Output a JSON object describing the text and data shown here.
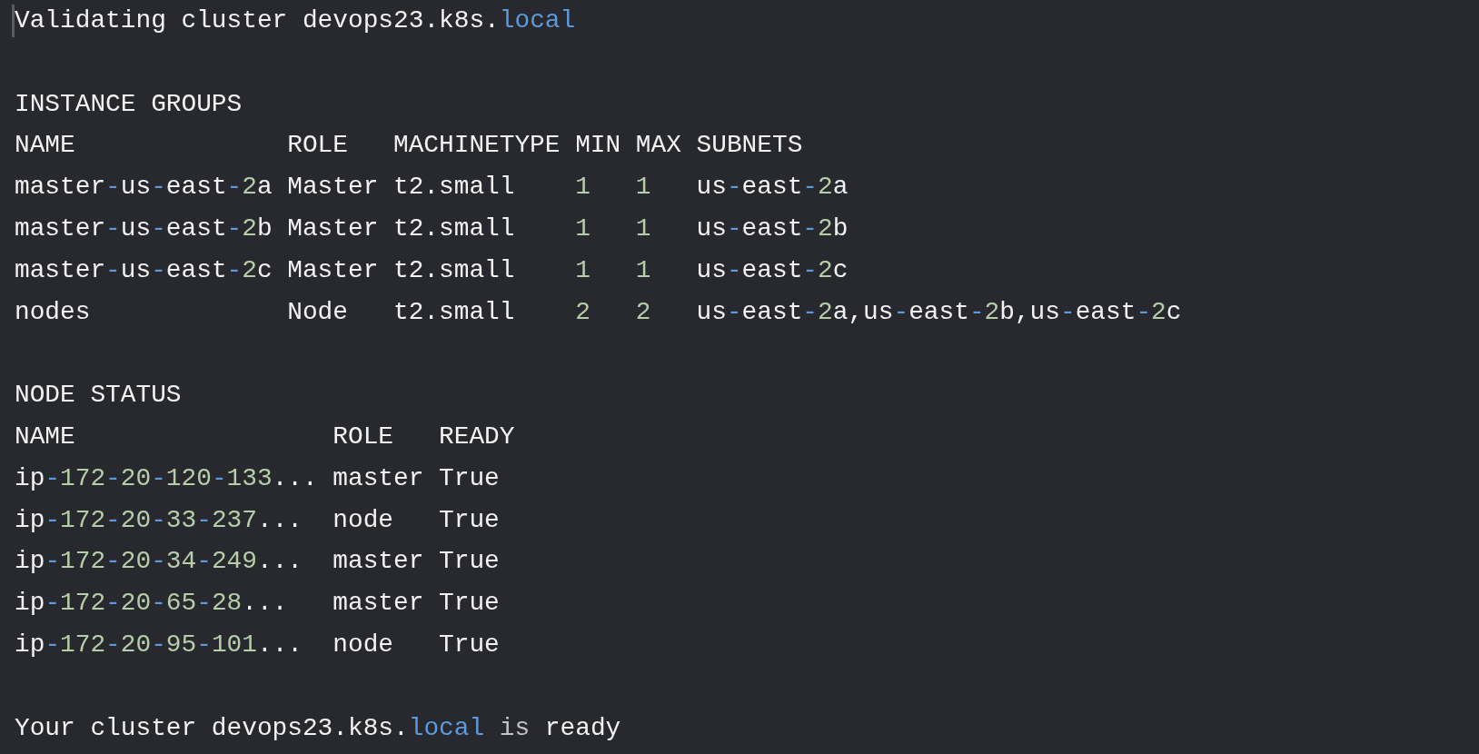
{
  "title_line": [
    {
      "text": "Validating cluster devops23.k8s.",
      "kind": "plain"
    },
    {
      "text": "local",
      "kind": "accent"
    }
  ],
  "instance_groups": {
    "heading": "INSTANCE GROUPS",
    "columns": [
      "NAME",
      "ROLE",
      "MACHINETYPE",
      "MIN",
      "MAX",
      "SUBNETS"
    ],
    "rows": [
      [
        [
          {
            "text": "master",
            "kind": "plain"
          },
          {
            "text": "-",
            "kind": "accent"
          },
          {
            "text": "us",
            "kind": "plain"
          },
          {
            "text": "-",
            "kind": "accent"
          },
          {
            "text": "east",
            "kind": "plain"
          },
          {
            "text": "-",
            "kind": "accent"
          },
          {
            "text": "2",
            "kind": "number"
          },
          {
            "text": "a",
            "kind": "plain"
          }
        ],
        [
          {
            "text": "Master",
            "kind": "plain"
          }
        ],
        [
          {
            "text": "t2.small",
            "kind": "plain"
          }
        ],
        [
          {
            "text": "1",
            "kind": "number"
          }
        ],
        [
          {
            "text": "1",
            "kind": "number"
          }
        ],
        [
          {
            "text": "us",
            "kind": "plain"
          },
          {
            "text": "-",
            "kind": "accent"
          },
          {
            "text": "east",
            "kind": "plain"
          },
          {
            "text": "-",
            "kind": "accent"
          },
          {
            "text": "2",
            "kind": "number"
          },
          {
            "text": "a",
            "kind": "plain"
          }
        ]
      ],
      [
        [
          {
            "text": "master",
            "kind": "plain"
          },
          {
            "text": "-",
            "kind": "accent"
          },
          {
            "text": "us",
            "kind": "plain"
          },
          {
            "text": "-",
            "kind": "accent"
          },
          {
            "text": "east",
            "kind": "plain"
          },
          {
            "text": "-",
            "kind": "accent"
          },
          {
            "text": "2",
            "kind": "number"
          },
          {
            "text": "b",
            "kind": "plain"
          }
        ],
        [
          {
            "text": "Master",
            "kind": "plain"
          }
        ],
        [
          {
            "text": "t2.small",
            "kind": "plain"
          }
        ],
        [
          {
            "text": "1",
            "kind": "number"
          }
        ],
        [
          {
            "text": "1",
            "kind": "number"
          }
        ],
        [
          {
            "text": "us",
            "kind": "plain"
          },
          {
            "text": "-",
            "kind": "accent"
          },
          {
            "text": "east",
            "kind": "plain"
          },
          {
            "text": "-",
            "kind": "accent"
          },
          {
            "text": "2",
            "kind": "number"
          },
          {
            "text": "b",
            "kind": "plain"
          }
        ]
      ],
      [
        [
          {
            "text": "master",
            "kind": "plain"
          },
          {
            "text": "-",
            "kind": "accent"
          },
          {
            "text": "us",
            "kind": "plain"
          },
          {
            "text": "-",
            "kind": "accent"
          },
          {
            "text": "east",
            "kind": "plain"
          },
          {
            "text": "-",
            "kind": "accent"
          },
          {
            "text": "2",
            "kind": "number"
          },
          {
            "text": "c",
            "kind": "plain"
          }
        ],
        [
          {
            "text": "Master",
            "kind": "plain"
          }
        ],
        [
          {
            "text": "t2.small",
            "kind": "plain"
          }
        ],
        [
          {
            "text": "1",
            "kind": "number"
          }
        ],
        [
          {
            "text": "1",
            "kind": "number"
          }
        ],
        [
          {
            "text": "us",
            "kind": "plain"
          },
          {
            "text": "-",
            "kind": "accent"
          },
          {
            "text": "east",
            "kind": "plain"
          },
          {
            "text": "-",
            "kind": "accent"
          },
          {
            "text": "2",
            "kind": "number"
          },
          {
            "text": "c",
            "kind": "plain"
          }
        ]
      ],
      [
        [
          {
            "text": "nodes",
            "kind": "plain"
          }
        ],
        [
          {
            "text": "Node",
            "kind": "plain"
          }
        ],
        [
          {
            "text": "t2.small",
            "kind": "plain"
          }
        ],
        [
          {
            "text": "2",
            "kind": "number"
          }
        ],
        [
          {
            "text": "2",
            "kind": "number"
          }
        ],
        [
          {
            "text": "us",
            "kind": "plain"
          },
          {
            "text": "-",
            "kind": "accent"
          },
          {
            "text": "east",
            "kind": "plain"
          },
          {
            "text": "-",
            "kind": "accent"
          },
          {
            "text": "2",
            "kind": "number"
          },
          {
            "text": "a,us",
            "kind": "plain"
          },
          {
            "text": "-",
            "kind": "accent"
          },
          {
            "text": "east",
            "kind": "plain"
          },
          {
            "text": "-",
            "kind": "accent"
          },
          {
            "text": "2",
            "kind": "number"
          },
          {
            "text": "b,us",
            "kind": "plain"
          },
          {
            "text": "-",
            "kind": "accent"
          },
          {
            "text": "east",
            "kind": "plain"
          },
          {
            "text": "-",
            "kind": "accent"
          },
          {
            "text": "2",
            "kind": "number"
          },
          {
            "text": "c",
            "kind": "plain"
          }
        ]
      ]
    ]
  },
  "node_status": {
    "heading": "NODE STATUS",
    "columns": [
      "NAME",
      "ROLE",
      "READY"
    ],
    "rows": [
      [
        [
          {
            "text": "ip",
            "kind": "plain"
          },
          {
            "text": "-",
            "kind": "accent"
          },
          {
            "text": "172",
            "kind": "number"
          },
          {
            "text": "-",
            "kind": "accent"
          },
          {
            "text": "20",
            "kind": "number"
          },
          {
            "text": "-",
            "kind": "accent"
          },
          {
            "text": "120",
            "kind": "number"
          },
          {
            "text": "-",
            "kind": "accent"
          },
          {
            "text": "133",
            "kind": "number"
          },
          {
            "text": "...",
            "kind": "plain"
          }
        ],
        [
          {
            "text": "master",
            "kind": "plain"
          }
        ],
        [
          {
            "text": "True",
            "kind": "plain"
          }
        ]
      ],
      [
        [
          {
            "text": "ip",
            "kind": "plain"
          },
          {
            "text": "-",
            "kind": "accent"
          },
          {
            "text": "172",
            "kind": "number"
          },
          {
            "text": "-",
            "kind": "accent"
          },
          {
            "text": "20",
            "kind": "number"
          },
          {
            "text": "-",
            "kind": "accent"
          },
          {
            "text": "33",
            "kind": "number"
          },
          {
            "text": "-",
            "kind": "accent"
          },
          {
            "text": "237",
            "kind": "number"
          },
          {
            "text": "...",
            "kind": "plain"
          }
        ],
        [
          {
            "text": "node",
            "kind": "plain"
          }
        ],
        [
          {
            "text": "True",
            "kind": "plain"
          }
        ]
      ],
      [
        [
          {
            "text": "ip",
            "kind": "plain"
          },
          {
            "text": "-",
            "kind": "accent"
          },
          {
            "text": "172",
            "kind": "number"
          },
          {
            "text": "-",
            "kind": "accent"
          },
          {
            "text": "20",
            "kind": "number"
          },
          {
            "text": "-",
            "kind": "accent"
          },
          {
            "text": "34",
            "kind": "number"
          },
          {
            "text": "-",
            "kind": "accent"
          },
          {
            "text": "249",
            "kind": "number"
          },
          {
            "text": "...",
            "kind": "plain"
          }
        ],
        [
          {
            "text": "master",
            "kind": "plain"
          }
        ],
        [
          {
            "text": "True",
            "kind": "plain"
          }
        ]
      ],
      [
        [
          {
            "text": "ip",
            "kind": "plain"
          },
          {
            "text": "-",
            "kind": "accent"
          },
          {
            "text": "172",
            "kind": "number"
          },
          {
            "text": "-",
            "kind": "accent"
          },
          {
            "text": "20",
            "kind": "number"
          },
          {
            "text": "-",
            "kind": "accent"
          },
          {
            "text": "65",
            "kind": "number"
          },
          {
            "text": "-",
            "kind": "accent"
          },
          {
            "text": "28",
            "kind": "number"
          },
          {
            "text": "...",
            "kind": "plain"
          }
        ],
        [
          {
            "text": "master",
            "kind": "plain"
          }
        ],
        [
          {
            "text": "True",
            "kind": "plain"
          }
        ]
      ],
      [
        [
          {
            "text": "ip",
            "kind": "plain"
          },
          {
            "text": "-",
            "kind": "accent"
          },
          {
            "text": "172",
            "kind": "number"
          },
          {
            "text": "-",
            "kind": "accent"
          },
          {
            "text": "20",
            "kind": "number"
          },
          {
            "text": "-",
            "kind": "accent"
          },
          {
            "text": "95",
            "kind": "number"
          },
          {
            "text": "-",
            "kind": "accent"
          },
          {
            "text": "101",
            "kind": "number"
          },
          {
            "text": "...",
            "kind": "plain"
          }
        ],
        [
          {
            "text": "node",
            "kind": "plain"
          }
        ],
        [
          {
            "text": "True",
            "kind": "plain"
          }
        ]
      ]
    ]
  },
  "footer_line": [
    {
      "text": "Your cluster devops23.k8s.",
      "kind": "plain"
    },
    {
      "text": "local",
      "kind": "accent"
    },
    {
      "text": " is",
      "kind": "muted"
    },
    {
      "text": " ready",
      "kind": "plain"
    }
  ]
}
